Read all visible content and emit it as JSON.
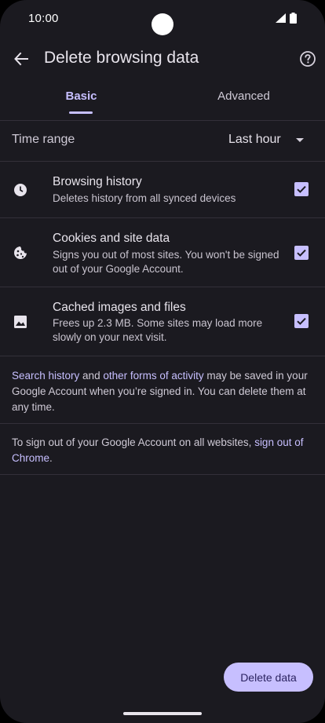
{
  "status_bar": {
    "time": "10:00"
  },
  "app_bar": {
    "title": "Delete browsing data"
  },
  "tabs": [
    {
      "label": "Basic",
      "selected": true
    },
    {
      "label": "Advanced",
      "selected": false
    }
  ],
  "time_range": {
    "label": "Time range",
    "value": "Last hour"
  },
  "options": [
    {
      "title": "Browsing history",
      "description": "Deletes history from all synced devices",
      "checked": true,
      "icon": "clock-icon"
    },
    {
      "title": "Cookies and site data",
      "description": "Signs you out of most sites. You won't be signed out of your Google Account.",
      "checked": true,
      "icon": "cookie-icon"
    },
    {
      "title": "Cached images and files",
      "description": "Frees up 2.3 MB. Some sites may load more slowly on your next visit.",
      "checked": true,
      "icon": "image-icon"
    }
  ],
  "info": {
    "link_search_history": "Search history",
    "and_text": " and ",
    "link_other_activity": "other forms of activity",
    "rest_text": " may be saved in your Google Account when you’re signed in. You can delete them at any time."
  },
  "signout": {
    "text": "To sign out of your Google Account on all websites, ",
    "link": "sign out of Chrome",
    "end": "."
  },
  "actions": {
    "delete_label": "Delete data"
  },
  "colors": {
    "accent": "#c7bfff",
    "background": "#1b1a20",
    "divider": "#333039"
  }
}
